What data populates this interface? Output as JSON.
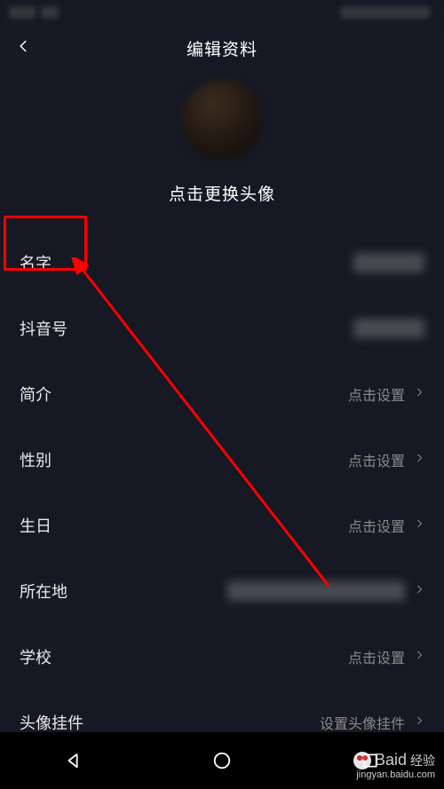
{
  "header": {
    "title": "编辑资料"
  },
  "avatar": {
    "hint": "点击更换头像"
  },
  "rows": [
    {
      "label": "名字",
      "value": "",
      "value_blurred": true,
      "chevron": false,
      "highlight": true
    },
    {
      "label": "抖音号",
      "value": "",
      "value_blurred": true,
      "chevron": false
    },
    {
      "label": "简介",
      "value": "点击设置",
      "chevron": true
    },
    {
      "label": "性别",
      "value": "点击设置",
      "chevron": true
    },
    {
      "label": "生日",
      "value": "点击设置",
      "chevron": true
    },
    {
      "label": "所在地",
      "value": "",
      "value_blurred": true,
      "blur_wide": true,
      "chevron": true
    },
    {
      "label": "学校",
      "value": "点击设置",
      "chevron": true
    },
    {
      "label": "头像挂件",
      "value": "设置头像挂件",
      "chevron": true
    }
  ],
  "watermark": {
    "brand": "Baid",
    "suffix": "经验",
    "url": "jingyan.baidu.com"
  }
}
